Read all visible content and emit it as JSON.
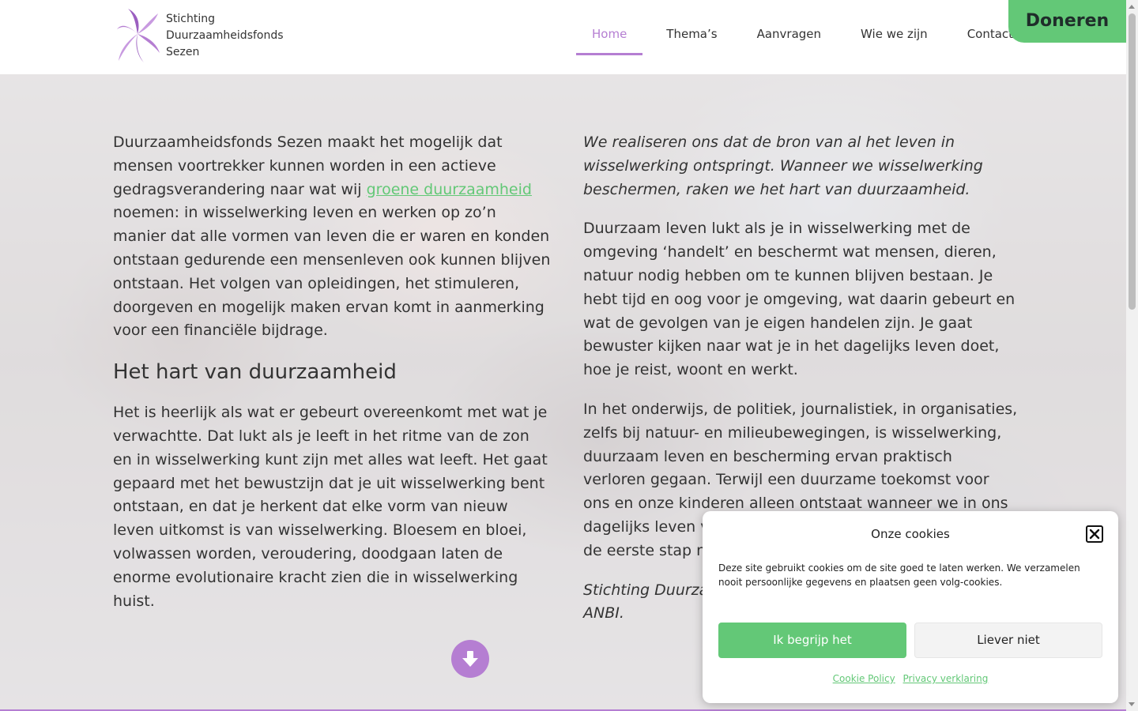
{
  "header": {
    "logo_lines": [
      "Stichting",
      "Duurzaamheidsfonds",
      "Sezen"
    ],
    "nav": [
      {
        "label": "Home",
        "active": true
      },
      {
        "label": "Thema’s",
        "active": false
      },
      {
        "label": "Aanvragen",
        "active": false
      },
      {
        "label": "Wie we zijn",
        "active": false
      },
      {
        "label": "Contact",
        "active": false
      }
    ],
    "donate_label": "Doneren"
  },
  "content": {
    "left": {
      "intro_before_link": "Duurzaamheidsfonds Sezen maakt het mogelijk dat mensen voortrekker kunnen worden in een actieve gedragsverandering naar wat wij ",
      "intro_link": "groene duurzaamheid",
      "intro_after_link": " noemen: in wisselwerking leven en werken op zo’n manier dat alle vormen van leven die er waren en konden ontstaan gedurende een mensenleven ook kunnen blijven ontstaan. Het volgen van opleidingen, het stimuleren, doorgeven en mogelijk maken ervan komt in aanmerking voor een financiële bijdrage.",
      "heading": "Het hart van duurzaamheid",
      "paragraph": "Het is heerlijk als wat er gebeurt overeenkomt met wat je verwachtte. Dat lukt als je leeft in het ritme van de zon en in wisselwerking kunt zijn met alles wat leeft. Het gaat gepaard met het bewustzijn dat je uit wisselwerking bent ontstaan, en dat je herkent dat elke vorm van nieuw leven uitkomst is van wisselwerking. Bloesem en bloei, volwassen worden, veroudering, doodgaan laten de enorme evolutionaire kracht zien die in wisselwerking huist."
    },
    "right": {
      "quote": "We realiseren ons dat de bron van al het leven in wisselwerking ontspringt. Wanneer we wisselwerking beschermen, raken we het hart van duurzaamheid.",
      "paragraph1": "Duurzaam leven lukt als je in wisselwerking met de omgeving ‘handelt’ en beschermt wat mensen, dieren, natuur nodig hebben om te kunnen blijven bestaan. Je hebt tijd en oog voor je omgeving, wat daarin gebeurt en wat de gevolgen van je eigen handelen zijn. Je gaat bewuster kijken naar wat je in het dagelijks leven doet, hoe je reist, woont en werkt.",
      "paragraph2": "In het onderwijs, de politiek, journalistiek, in organisaties, zelfs bij natuur- en milieubewegingen, is wisselwerking, duurzaam leven en bescherming ervan praktisch verloren gegaan. Terwijl een duurzame toekomst voor ons en onze kinderen alleen ontstaat wanneer we in ons dagelijks leven van wisselwerking uit blijven gaan. Dat is de eerste stap naar herstel van evenwicht.",
      "closing": "Stichting Duurzaamheidsfonds Sezen is erkend als een ANBI."
    },
    "scroll_down_icon": "arrow-down-circle-icon"
  },
  "cookie": {
    "title": "Onze cookies",
    "text": "Deze site gebruikt cookies om de site goed te laten werken. We verzamelen nooit persoonlijke gegevens en plaatsen geen volg-cookies.",
    "accept_label": "Ik begrijp het",
    "deny_label": "Liever niet",
    "links": [
      "Cookie Policy",
      "Privacy verklaring"
    ],
    "close_icon": "close-icon"
  },
  "colors": {
    "accent_purple": "#b57ed2",
    "accent_green": "#63c877"
  }
}
